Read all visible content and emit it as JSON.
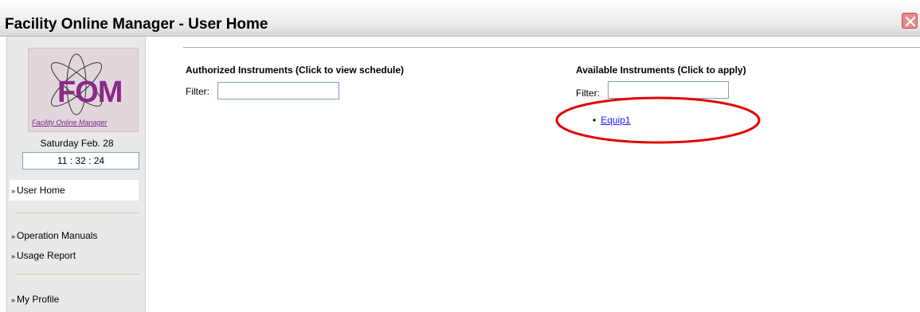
{
  "window": {
    "title": "Facility Online Manager - User Home"
  },
  "sidebar": {
    "logo_text": "FOM",
    "logo_subtitle": "Facility Online Manager",
    "date": "Saturday Feb. 28",
    "clock": "11 : 32 : 24",
    "nav_marker": "»",
    "items": [
      {
        "label": "User Home",
        "active": true
      },
      {
        "label": "Operation Manuals"
      },
      {
        "label": "Usage Report"
      },
      {
        "label": "My Profile"
      }
    ]
  },
  "authorized": {
    "title": "Authorized Instruments (Click to view schedule)",
    "filter_label": "Filter:",
    "filter_value": ""
  },
  "available": {
    "title": "Available Instruments (Click to apply)",
    "filter_label": "Filter:",
    "filter_value": "",
    "items": [
      "Equip1"
    ],
    "bullet": "•"
  },
  "colors": {
    "highlight": "#e00000",
    "link": "#1a1aff",
    "logo_accent": "#8a2a8a"
  }
}
